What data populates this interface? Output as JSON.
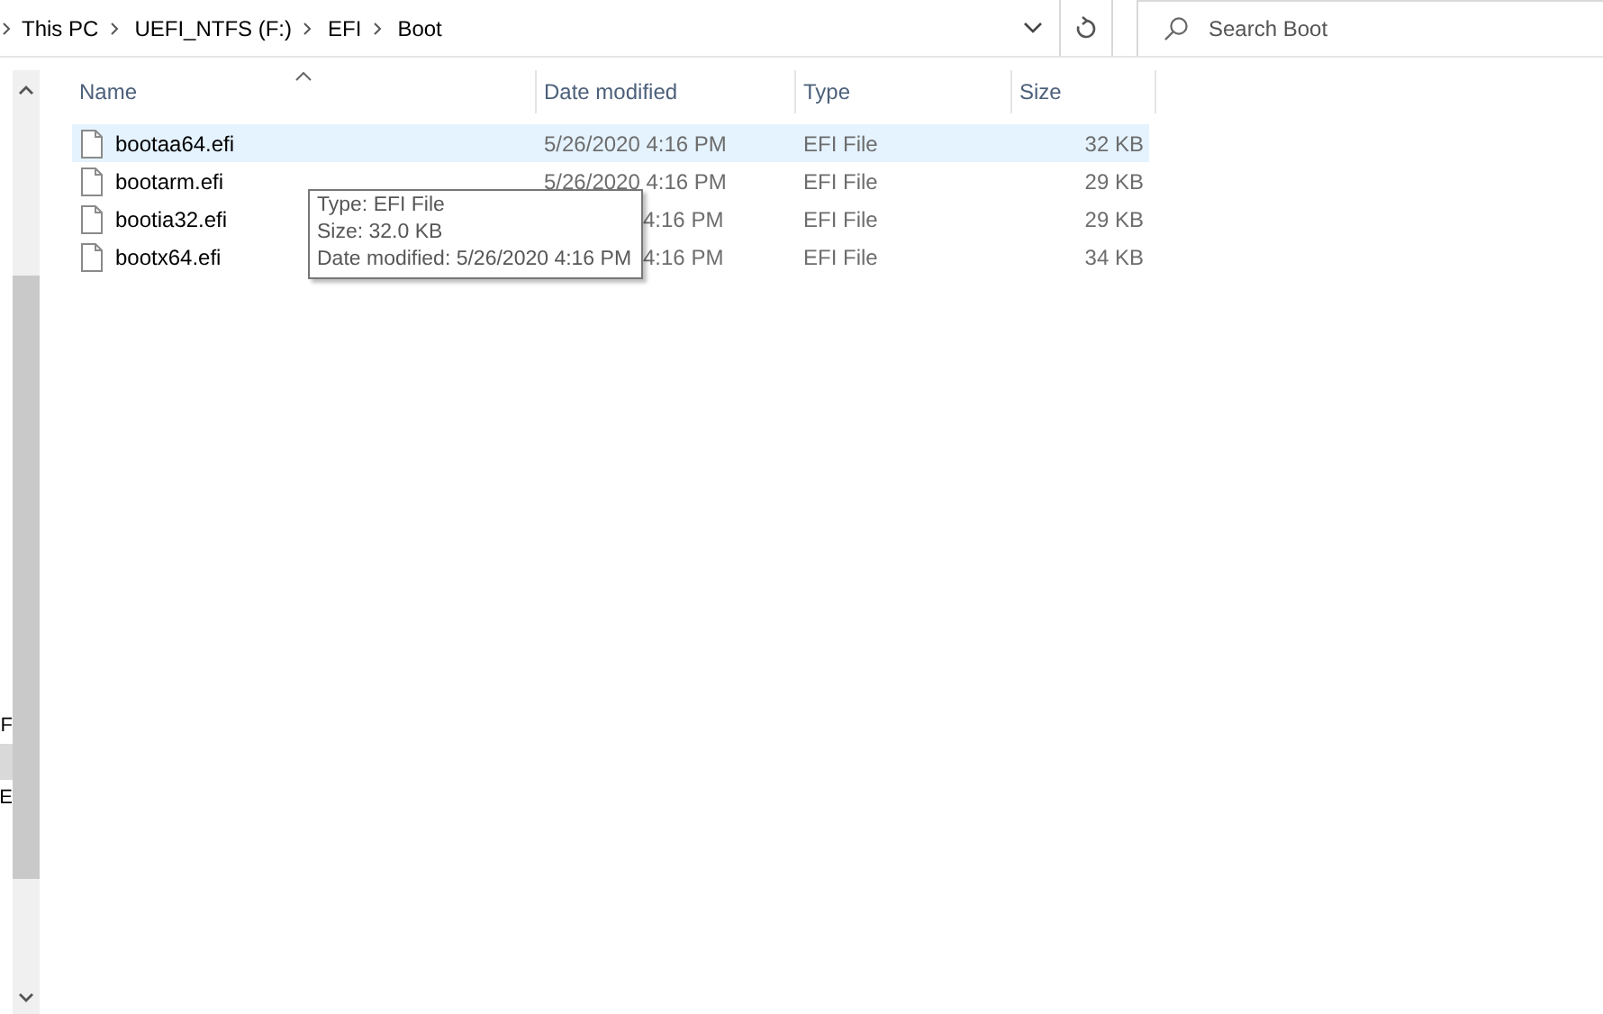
{
  "breadcrumb": [
    "This PC",
    "UEFI_NTFS (F:)",
    "EFI",
    "Boot"
  ],
  "search": {
    "placeholder": "Search Boot"
  },
  "nav_pane": {
    "items": [
      {
        "label": "F",
        "selected": false
      },
      {
        "selected": true
      },
      {
        "label": "E",
        "selected": false
      }
    ]
  },
  "table": {
    "columns": [
      "Name",
      "Date modified",
      "Type",
      "Size"
    ],
    "rows": [
      {
        "name": "bootaa64.efi",
        "date": "5/26/2020 4:16 PM",
        "type": "EFI File",
        "size": "32 KB",
        "hovered": true,
        "date_covered": false
      },
      {
        "name": "bootarm.efi",
        "date": "5/26/2020 4:16 PM",
        "type": "EFI File",
        "size": "29 KB",
        "hovered": false,
        "date_covered": false
      },
      {
        "name": "bootia32.efi",
        "date": "4:16 PM",
        "type": "EFI File",
        "size": "29 KB",
        "hovered": false,
        "date_covered": true
      },
      {
        "name": "bootx64.efi",
        "date": "4:16 PM",
        "type": "EFI File",
        "size": "34 KB",
        "hovered": false,
        "date_covered": true
      }
    ]
  },
  "tooltip": [
    "Type: EFI File",
    "Size: 32.0 KB",
    "Date modified: 5/26/2020 4:16 PM"
  ]
}
